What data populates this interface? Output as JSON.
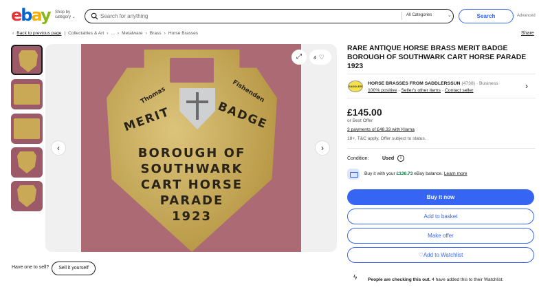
{
  "header": {
    "logo": {
      "e": "e",
      "b": "b",
      "a": "a",
      "y": "y"
    },
    "shop_by": "Shop by",
    "category": "category",
    "search_placeholder": "Search for anything",
    "category_select": "All Categories",
    "search_button": "Search",
    "advanced": "Advanced"
  },
  "breadcrumb": {
    "back": "Back to previous page",
    "items": [
      "Collectables & Art",
      "...",
      "Metalware",
      "Brass",
      "Horse Brasses"
    ],
    "share": "Share"
  },
  "gallery": {
    "counter": "4",
    "engraving": {
      "name_left": "Thomas",
      "name_right": "Fishenden",
      "word_left": "MERIT",
      "word_right": "BADGE",
      "line1": "BOROUGH OF",
      "line2": "SOUTHWARK",
      "line3": "CART HORSE",
      "line4": "PARADE",
      "line5": "1923"
    }
  },
  "sell": {
    "question": "Have one to sell?",
    "button": "Sell it yourself"
  },
  "listing": {
    "title": "RARE ANTIQUE HORSE BRASS MERIT BADGE BOROUGH OF SOUTHWARK CART HORSE PARADE 1923",
    "seller": {
      "logo_text": "SADDLERSSUN",
      "name": "HORSE BRASSES FROM SADDLERSSUN",
      "count": "(4738)",
      "type": "· Business",
      "positive": "100% positive",
      "other_items": "Seller's other items",
      "contact": "Contact seller"
    },
    "price": "£145.00",
    "best_offer": "or Best Offer",
    "klarna": "3 payments of £48.33 with Klarna",
    "tc": "18+, T&C apply. Offer subject to status.",
    "condition_label": "Condition:",
    "condition_value": "Used",
    "balance_pre": "Buy it with your ",
    "balance_amount": "£136.73",
    "balance_post": " eBay balance. ",
    "balance_link": "Learn more",
    "buttons": {
      "buy": "Buy it now",
      "basket": "Add to basket",
      "offer": "Make offer",
      "watch": "♡Add to Watchlist"
    },
    "watchers_bold": "People are checking this out.",
    "watchers_rest": " 4 have added this to their Watchlist."
  },
  "colors": {
    "accent": "#3665f3",
    "green": "#05823f"
  }
}
